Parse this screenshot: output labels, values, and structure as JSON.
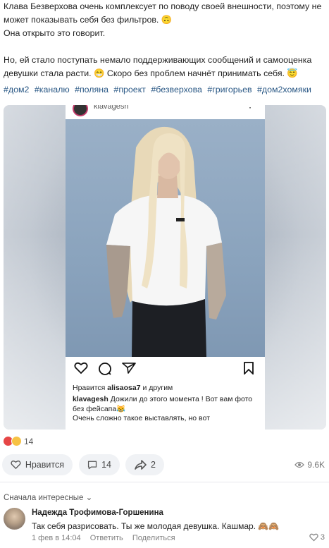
{
  "post": {
    "paragraph1": "Клава Безверхова очень комплексует по поводу своей внешности, поэтому не может показывать себя без фильтров. 🙃",
    "paragraph2": "Она открыто это говорит.",
    "paragraph3": "Но, ей стало поступать немало поддерживающих сообщений и самооценка девушки стала расти. 😁 Скоро без проблем начнёт принимать себя. 😇",
    "hashtags": [
      "#дом2",
      "#каналю",
      "#поляна",
      "#проект",
      "#безверхова",
      "#григорьев",
      "#дом2хомяки"
    ]
  },
  "instagram": {
    "username": "klavagesh",
    "likes_prefix": "Нравится",
    "likes_user": "alisaosa7",
    "likes_suffix": "и другим",
    "caption_user": "klavagesh",
    "caption_text": "Дожили до этого момента ! Вот вам фото без фейсапа😹",
    "caption_more": "Очень сложно такое выставлять, но вот"
  },
  "reactions": {
    "count": "14"
  },
  "actions": {
    "like_label": "Нравится",
    "comments_count": "14",
    "shares_count": "2",
    "views": "9.6K"
  },
  "comments": {
    "sort_label": "Сначала интересные",
    "items": [
      {
        "author": "Надежда Трофимова-Горшенина",
        "text": "Так себя разрисовать. Ты же молодая девушка. Кашмар. 🙈🙈",
        "date": "1 фев в 14:04",
        "reply": "Ответить",
        "share": "Поделиться",
        "likes": "3"
      }
    ]
  },
  "colors": {
    "link": "#2a5885",
    "accent_red": "#e64646"
  }
}
